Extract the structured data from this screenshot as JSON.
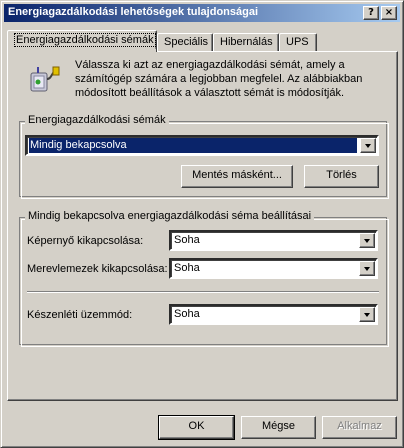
{
  "window": {
    "title": "Energiagazdálkodási lehetőségek tulajdonságai",
    "help_label": "?",
    "close_label": "×"
  },
  "tabs": [
    {
      "label": "Energiagazdálkodási sémák",
      "active": true
    },
    {
      "label": "Speciális",
      "active": false
    },
    {
      "label": "Hibernálás",
      "active": false
    },
    {
      "label": "UPS",
      "active": false
    }
  ],
  "intro": {
    "icon": "power-scheme-icon",
    "text": "Válassza ki azt az energiagazdálkodási sémát, amely a számítógép számára a legjobban megfelel. Az alábbiakban módosított beállítások a választott sémát is módosítják."
  },
  "schemes": {
    "group_label": "Energiagazdálkodási sémák",
    "selected": "Mindig bekapcsolva",
    "save_as_label": "Mentés másként...",
    "delete_label": "Törlés"
  },
  "settings": {
    "group_label": "Mindig bekapcsolva energiagazdálkodási séma beállításai",
    "monitor_label": "Képernyő kikapcsolása:",
    "monitor_value": "Soha",
    "disks_label": "Merevlemezek kikapcsolása:",
    "disks_value": "Soha",
    "standby_label": "Készenléti üzemmód:",
    "standby_value": "Soha"
  },
  "footer": {
    "ok_label": "OK",
    "cancel_label": "Mégse",
    "apply_label": "Alkalmaz"
  },
  "colors": {
    "titlebar_start": "#0a246a",
    "titlebar_end": "#a6caf0",
    "face": "#d4d0c8",
    "selection": "#0a246a"
  }
}
